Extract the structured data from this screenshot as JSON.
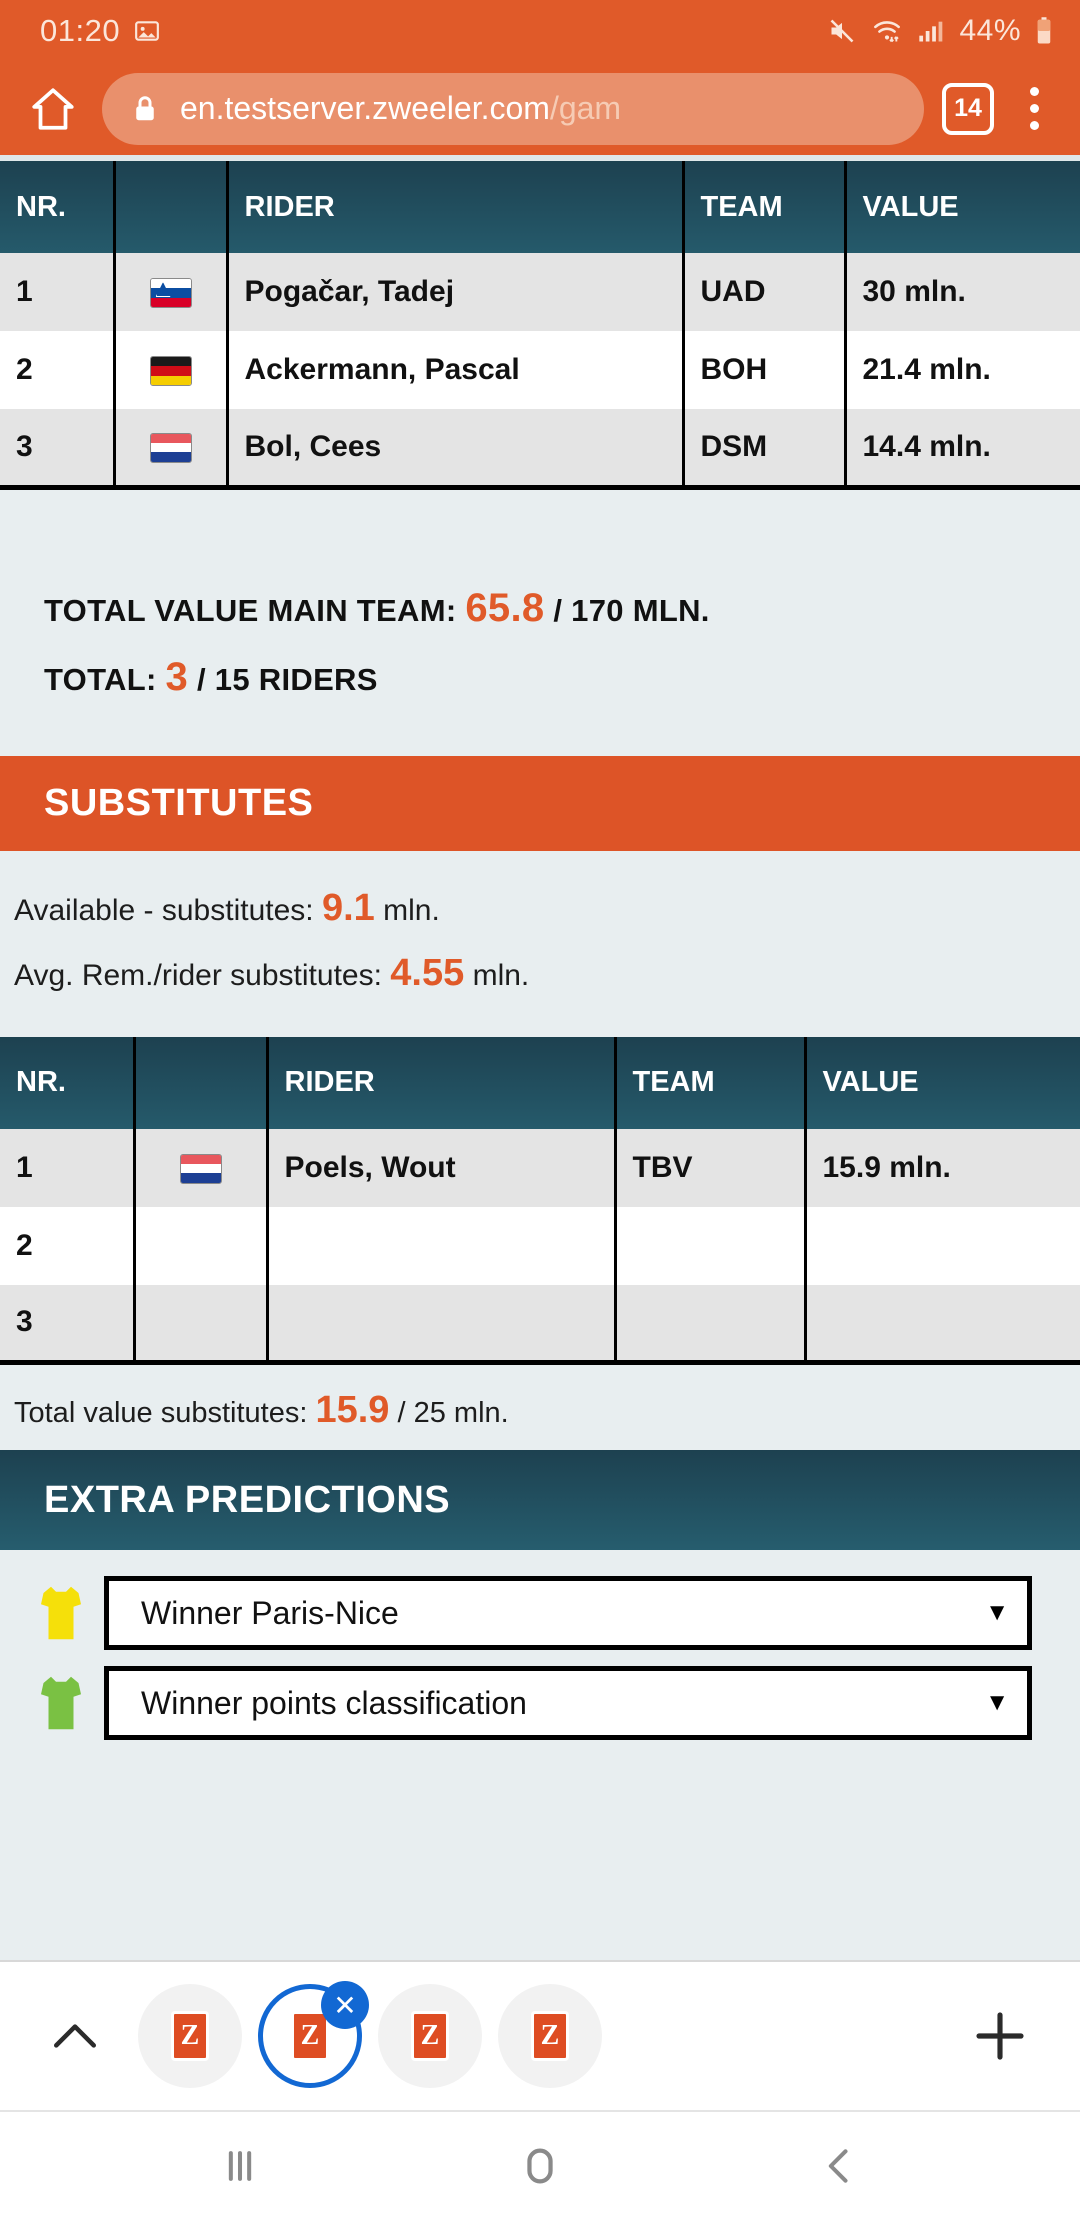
{
  "status_bar": {
    "clock": "01:20",
    "battery_percent": "44%",
    "icons": [
      "image-icon",
      "mute-icon",
      "wifi-icon",
      "signal-icon",
      "battery-icon"
    ]
  },
  "browser": {
    "home_icon": "home-icon",
    "lock_icon": "lock-icon",
    "url_visible": "en.testserver.zweeler.com",
    "url_dim": "/gam",
    "tab_count": "14",
    "menu_icon": "kebab-menu-icon"
  },
  "main_team": {
    "columns": [
      "NR.",
      "",
      "RIDER",
      "TEAM",
      "VALUE"
    ],
    "rows": [
      {
        "nr": "1",
        "flag": "si",
        "rider": "Pogačar, Tadej",
        "team": "UAD",
        "value": "30 mln."
      },
      {
        "nr": "2",
        "flag": "de",
        "rider": "Ackermann, Pascal",
        "team": "BOH",
        "value": "21.4 mln."
      },
      {
        "nr": "3",
        "flag": "nl",
        "rider": "Bol, Cees",
        "team": "DSM",
        "value": "14.4 mln."
      }
    ],
    "total_value_label": "TOTAL VALUE MAIN TEAM:",
    "total_value_amount": "65.8",
    "total_value_suffix": "/ 170 MLN.",
    "total_label": "TOTAL:",
    "total_count": "3",
    "total_suffix": "/ 15 RIDERS"
  },
  "substitutes": {
    "header": "SUBSTITUTES",
    "available_label": "Available - substitutes:",
    "available_value": "9.1",
    "available_unit": "mln.",
    "avg_label": "Avg. Rem./rider substitutes:",
    "avg_value": "4.55",
    "avg_unit": "mln.",
    "columns": [
      "NR.",
      "",
      "RIDER",
      "TEAM",
      "VALUE"
    ],
    "rows": [
      {
        "nr": "1",
        "flag": "nl",
        "rider": "Poels, Wout",
        "team": "TBV",
        "value": "15.9 mln."
      },
      {
        "nr": "2",
        "flag": "",
        "rider": "",
        "team": "",
        "value": ""
      },
      {
        "nr": "3",
        "flag": "",
        "rider": "",
        "team": "",
        "value": ""
      }
    ],
    "total_label": "Total value substitutes:",
    "total_value": "15.9",
    "total_suffix": "/ 25 mln."
  },
  "extra_predictions": {
    "header": "EXTRA PREDICTIONS",
    "items": [
      {
        "jersey": "yellow-jersey-icon",
        "jersey_color": "#f5e00a",
        "label": "Winner Paris-Nice",
        "caret": "▼"
      },
      {
        "jersey": "green-jersey-icon",
        "jersey_color": "#7ac143",
        "label": "Winner points classification",
        "caret": "▼"
      }
    ]
  },
  "tab_strip": {
    "expand_icon": "chevron-up-icon",
    "tabs": [
      {
        "logo": "Z",
        "active": false
      },
      {
        "logo": "Z",
        "active": true,
        "close_label": "✕"
      },
      {
        "logo": "Z",
        "active": false
      },
      {
        "logo": "Z",
        "active": false
      }
    ],
    "new_tab_icon": "plus-icon"
  },
  "nav_bar": {
    "recents_icon": "recents-icon",
    "home_icon": "home-circle-icon",
    "back_icon": "back-chevron-icon"
  },
  "colors": {
    "orange": "#e05a29",
    "dark_teal": "#1d4150",
    "page_bg": "#e8eef0",
    "accent_blue": "#1268d3"
  }
}
